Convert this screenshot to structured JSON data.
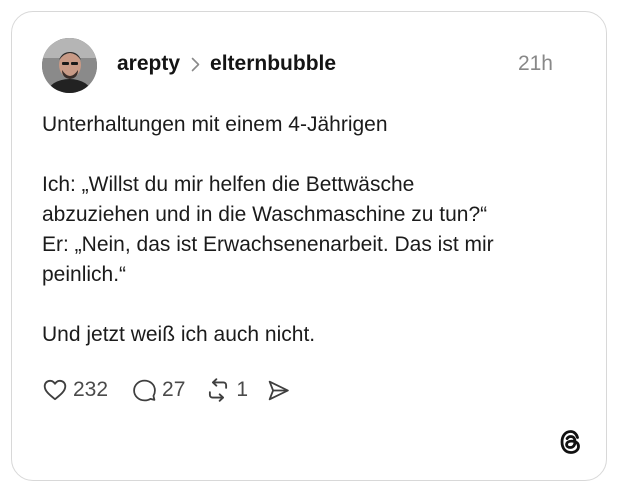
{
  "post": {
    "author": "arepty",
    "community": "elternbubble",
    "time": "21h",
    "lines": [
      "Unterhaltungen mit einem 4-Jährigen",
      "",
      "Ich: „Willst du mir helfen die Bettwäsche",
      "abzuziehen und in die Waschmaschine zu tun?“",
      "Er: „Nein, das ist Erwachsenenarbeit. Das ist mir",
      "peinlich.“",
      "",
      "Und jetzt weiß ich auch nicht."
    ]
  },
  "actions": {
    "likes": "232",
    "replies": "27",
    "reposts": "1"
  },
  "icons": {
    "like": "heart-icon",
    "reply": "speech-bubble-icon",
    "repost": "repost-icon",
    "share": "send-icon",
    "brand": "threads-logo-icon",
    "separator": "chevron-right-icon"
  },
  "colors": {
    "text": "#1b1b1b",
    "muted": "#888888",
    "border": "#d8d8d8"
  }
}
